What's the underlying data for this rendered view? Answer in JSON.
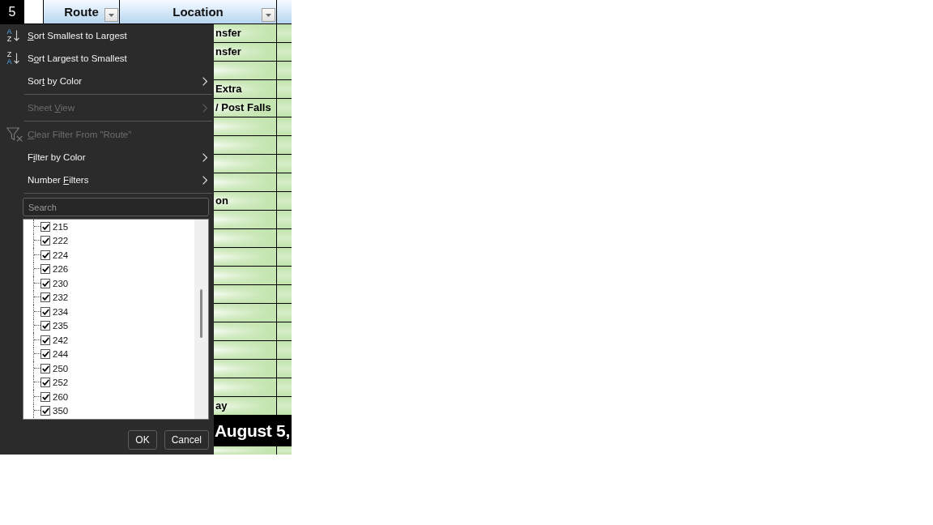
{
  "sheet": {
    "row_header": "5",
    "columns": [
      {
        "label": "Route",
        "filter_button": true
      },
      {
        "label": "Location",
        "filter_button": true
      }
    ],
    "rows": [
      {
        "location": "nsfer"
      },
      {
        "location": "nsfer"
      },
      {},
      {
        "location": "Extra"
      },
      {
        "location": "/ Post Falls"
      },
      {},
      {},
      {},
      {},
      {
        "location": "on"
      },
      {},
      {},
      {},
      {},
      {},
      {},
      {},
      {},
      {},
      {},
      {
        "location": "ay"
      }
    ],
    "banner": "August 5,"
  },
  "menu": {
    "groups": [
      [
        {
          "kind": "ascending",
          "icon_glyphs": [
            "A",
            "Z"
          ],
          "label": {
            "key": "S",
            "post": "ort Smallest to Largest"
          },
          "disabled": false
        },
        {
          "kind": "descending",
          "icon_glyphs": [
            "Z",
            "A"
          ],
          "label": {
            "pre": "S",
            "key": "o",
            "post": "rt Largest to Smallest"
          },
          "disabled": false
        },
        {
          "kind": "submenu",
          "label": {
            "pre": "Sor",
            "key": "t",
            "post": " by Color"
          },
          "disabled": false
        }
      ],
      [
        {
          "kind": "submenu",
          "label": {
            "pre": "Sheet ",
            "key": "V",
            "post": "iew"
          },
          "disabled": true
        }
      ],
      [
        {
          "kind": "clear",
          "label": {
            "key": "C",
            "post": "lear Filter From \"Route\""
          },
          "disabled": true
        },
        {
          "kind": "submenu",
          "label": {
            "pre": "F",
            "key": "i",
            "post": "lter by Color"
          },
          "disabled": false
        },
        {
          "kind": "submenu",
          "label": {
            "pre": "Number ",
            "key": "F",
            "post": "ilters"
          },
          "disabled": false
        }
      ]
    ]
  },
  "filter_list": {
    "search": {
      "placeholder": "Search"
    },
    "items": [
      {
        "label": "215",
        "checked": true
      },
      {
        "label": "222",
        "checked": true
      },
      {
        "label": "224",
        "checked": true
      },
      {
        "label": "226",
        "checked": true
      },
      {
        "label": "230",
        "checked": true
      },
      {
        "label": "232",
        "checked": true
      },
      {
        "label": "234",
        "checked": true
      },
      {
        "label": "235",
        "checked": true
      },
      {
        "label": "242",
        "checked": true
      },
      {
        "label": "244",
        "checked": true
      },
      {
        "label": "250",
        "checked": true
      },
      {
        "label": "252",
        "checked": true
      },
      {
        "label": "260",
        "checked": true
      },
      {
        "label": "350",
        "checked": true
      }
    ]
  },
  "buttons": [
    "OK",
    "Cancel"
  ]
}
